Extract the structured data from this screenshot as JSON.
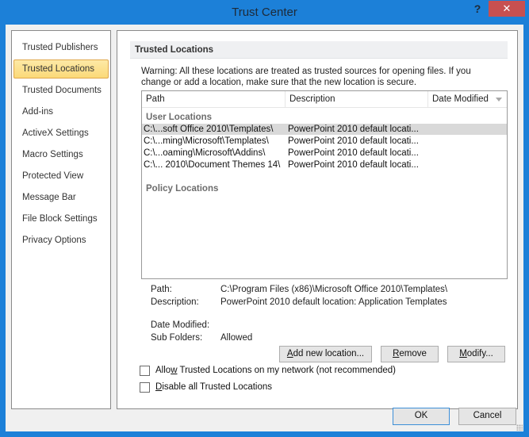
{
  "window": {
    "title": "Trust Center",
    "help_label": "?",
    "close_label": "✕"
  },
  "sidebar": {
    "items": [
      {
        "label": "Trusted Publishers",
        "selected": false
      },
      {
        "label": "Trusted Locations",
        "selected": true
      },
      {
        "label": "Trusted Documents",
        "selected": false
      },
      {
        "label": "Add-ins",
        "selected": false
      },
      {
        "label": "ActiveX Settings",
        "selected": false
      },
      {
        "label": "Macro Settings",
        "selected": false
      },
      {
        "label": "Protected View",
        "selected": false
      },
      {
        "label": "Message Bar",
        "selected": false
      },
      {
        "label": "File Block Settings",
        "selected": false
      },
      {
        "label": "Privacy Options",
        "selected": false
      }
    ]
  },
  "main": {
    "section_title": "Trusted Locations",
    "warning_line1": "Warning: All these locations are treated as trusted sources for opening files.  If you",
    "warning_line2": "change or add a location, make sure that the new location is secure.",
    "list": {
      "columns": [
        "Path",
        "Description",
        "Date Modified"
      ],
      "sort_column": "Date Modified",
      "groups": {
        "user": "User Locations",
        "policy": "Policy Locations"
      },
      "rows": [
        {
          "path": "C:\\...soft Office 2010\\Templates\\",
          "description": "PowerPoint 2010 default locati...",
          "date": "",
          "selected": true
        },
        {
          "path": "C:\\...ming\\Microsoft\\Templates\\",
          "description": "PowerPoint 2010 default locati...",
          "date": "",
          "selected": false
        },
        {
          "path": "C:\\...oaming\\Microsoft\\Addins\\",
          "description": "PowerPoint 2010 default locati...",
          "date": "",
          "selected": false
        },
        {
          "path": "C:\\... 2010\\Document Themes 14\\",
          "description": "PowerPoint 2010 default locati...",
          "date": "",
          "selected": false
        }
      ]
    },
    "details": {
      "path_label": "Path:",
      "path_value": "C:\\Program Files (x86)\\Microsoft Office 2010\\Templates\\",
      "description_label": "Description:",
      "description_value": "PowerPoint 2010 default location: Application Templates",
      "date_modified_label": "Date Modified:",
      "date_modified_value": "",
      "subfolders_label": "Sub Folders:",
      "subfolders_value": "Allowed"
    },
    "buttons": {
      "add_mnemonic": "A",
      "add_rest": "dd new location...",
      "remove_mnemonic": "R",
      "remove_rest": "emove",
      "modify_mnemonic": "M",
      "modify_rest": "odify..."
    },
    "checkboxes": {
      "allow_network_pre": "Allo",
      "allow_network_mnemonic": "w",
      "allow_network_post": " Trusted Locations on my network (not recommended)",
      "allow_network_checked": false,
      "disable_all_mnemonic": "D",
      "disable_all_post": "isable all Trusted Locations",
      "disable_all_checked": false
    }
  },
  "footer": {
    "ok_label": "OK",
    "cancel_label": "Cancel"
  }
}
